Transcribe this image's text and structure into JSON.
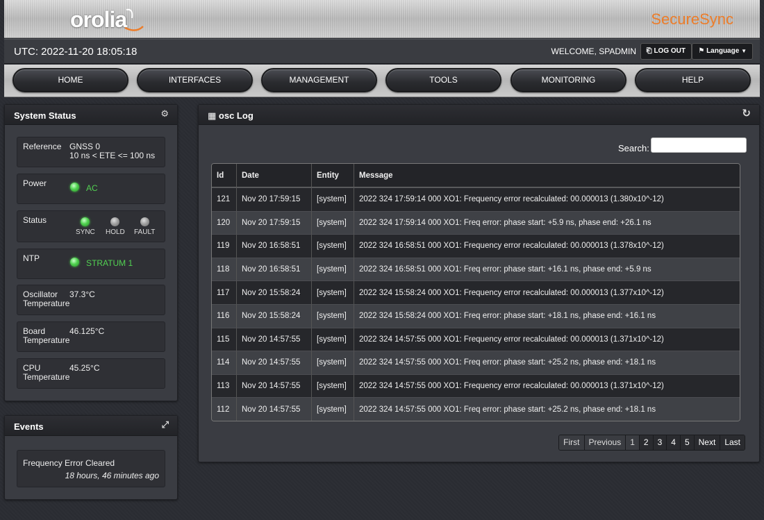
{
  "header": {
    "logo_text": "orolia",
    "product_name": "SecureSync",
    "utc": "UTC: 2022-11-20 18:05:18",
    "welcome": "WELCOME, SPADMIN",
    "logout_label": "LOG OUT",
    "language_label": "Language"
  },
  "nav": {
    "items": [
      "HOME",
      "INTERFACES",
      "MANAGEMENT",
      "TOOLS",
      "MONITORING",
      "HELP"
    ]
  },
  "system_status": {
    "title": "System Status",
    "reference": {
      "label": "Reference",
      "value_line1": "GNSS 0",
      "value_line2": "10 ns < ETE <= 100 ns"
    },
    "power": {
      "label": "Power",
      "value": "AC"
    },
    "status": {
      "label": "Status",
      "leds": [
        "SYNC",
        "HOLD",
        "FAULT"
      ]
    },
    "ntp": {
      "label": "NTP",
      "value": "STRATUM 1"
    },
    "osc_temp": {
      "label_line1": "Oscillator",
      "label_line2": "Temperature",
      "value": "37.3°C"
    },
    "board_temp": {
      "label_line1": "Board",
      "label_line2": "Temperature",
      "value": "46.125°C"
    },
    "cpu_temp": {
      "label_line1": "CPU",
      "label_line2": "Temperature",
      "value": "45.25°C"
    }
  },
  "events": {
    "title": "Events",
    "message": "Frequency Error Cleared",
    "time": "18 hours, 46 minutes ago"
  },
  "osc_log": {
    "title": "osc Log",
    "search_label": "Search:",
    "columns": [
      "Id",
      "Date",
      "Entity",
      "Message"
    ],
    "rows": [
      [
        "121",
        "Nov 20 17:59:15",
        "[system]",
        "2022 324 17:59:14 000 XO1: Frequency error recalculated: 00.000013 (1.380x10^-12)"
      ],
      [
        "120",
        "Nov 20 17:59:15",
        "[system]",
        "2022 324 17:59:14 000 XO1: Freq error: phase start: +5.9 ns, phase end: +26.1 ns"
      ],
      [
        "119",
        "Nov 20 16:58:51",
        "[system]",
        "2022 324 16:58:51 000 XO1: Frequency error recalculated: 00.000013 (1.378x10^-12)"
      ],
      [
        "118",
        "Nov 20 16:58:51",
        "[system]",
        "2022 324 16:58:51 000 XO1: Freq error: phase start: +16.1 ns, phase end: +5.9 ns"
      ],
      [
        "117",
        "Nov 20 15:58:24",
        "[system]",
        "2022 324 15:58:24 000 XO1: Frequency error recalculated: 00.000013 (1.377x10^-12)"
      ],
      [
        "116",
        "Nov 20 15:58:24",
        "[system]",
        "2022 324 15:58:24 000 XO1: Freq error: phase start: +18.1 ns, phase end: +16.1 ns"
      ],
      [
        "115",
        "Nov 20 14:57:55",
        "[system]",
        "2022 324 14:57:55 000 XO1: Frequency error recalculated: 00.000013 (1.371x10^-12)"
      ],
      [
        "114",
        "Nov 20 14:57:55",
        "[system]",
        "2022 324 14:57:55 000 XO1: Freq error: phase start: +25.2 ns, phase end: +18.1 ns"
      ],
      [
        "113",
        "Nov 20 14:57:55",
        "[system]",
        "2022 324 14:57:55 000 XO1: Frequency error recalculated: 00.000013 (1.371x10^-12)"
      ],
      [
        "112",
        "Nov 20 14:57:55",
        "[system]",
        "2022 324 14:57:55 000 XO1: Freq error: phase start: +25.2 ns, phase end: +18.1 ns"
      ]
    ],
    "pager": [
      "First",
      "Previous",
      "1",
      "2",
      "3",
      "4",
      "5",
      "Next",
      "Last"
    ]
  },
  "colors": {
    "brand_orange": "#ec7d2a",
    "status_green": "#52d152"
  },
  "icons": {
    "settings": "gear-icon",
    "expand": "expand-icon",
    "table": "table-icon",
    "refresh": "refresh-icon",
    "logout": "logout-icon",
    "flag": "flag-icon"
  }
}
